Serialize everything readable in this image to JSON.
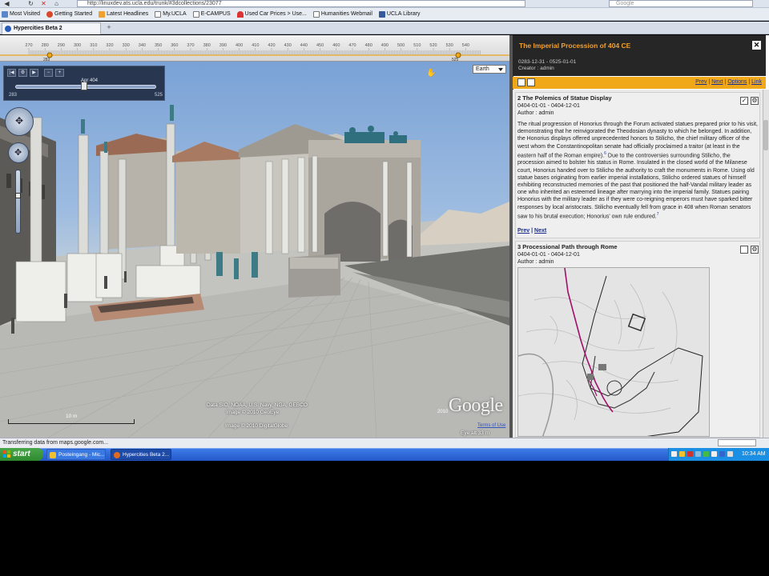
{
  "browser": {
    "url": "http://linuxdev.ats.ucla.edu/trunk/#3dcollections/23077",
    "search_placeholder": "Google",
    "bookmarks": [
      {
        "label": "Most Visited",
        "color": "#5b86c9"
      },
      {
        "label": "Getting Started",
        "color": "#d9482b"
      },
      {
        "label": "Latest Headlines",
        "color": "#f0a030"
      },
      {
        "label": "My.UCLA",
        "color": "#4a73b8"
      },
      {
        "label": "E-CAMPUS",
        "color": "#4a73b8"
      },
      {
        "label": "Used Car Prices > Use...",
        "color": "#d33"
      },
      {
        "label": "Humanities Webmail",
        "color": "#4a73b8"
      },
      {
        "label": "UCLA Library",
        "color": "#355a9c"
      }
    ],
    "tab_title": "Hypercities Beta 2",
    "status_text": "Transferring data from maps.google.com..."
  },
  "timeline": {
    "ticks": [
      "270",
      "280",
      "290",
      "300",
      "310",
      "320",
      "330",
      "340",
      "350",
      "360",
      "370",
      "380",
      "390",
      "400",
      "410",
      "420",
      "430",
      "440",
      "450",
      "460",
      "470",
      "480",
      "490",
      "500",
      "510",
      "520",
      "530",
      "540"
    ],
    "marker_left": "283",
    "marker_right": "525"
  },
  "earth": {
    "slider_label": "Apr 404",
    "slider_min": "283",
    "slider_max": "525",
    "slider_fraction": 0.5,
    "layer_select": "Earth",
    "footer_line1": "Data SIO, NOAA, U.S. Navy, NGA, GEBCO",
    "footer_line2": "Image © 2010 GeoEye",
    "footer_line3": "Image © 2010 DigitalGlobe",
    "google_logo": "Google",
    "google_year": "2010",
    "terms": "Terms of Use",
    "eye_alt": "Eye alt    33 m",
    "scale": "10 m"
  },
  "panel": {
    "title": "The Imperial Procession of 404 CE",
    "dates": "0283-12-31 - 0525-01-01",
    "creator": "Creator : admin",
    "nav": {
      "prev": "Prev",
      "next": "Next",
      "options": "Options",
      "link": "Link"
    },
    "cards": [
      {
        "title": "2 The Polemics of Statue Display",
        "dates": "0404-01-01 - 0404-12-01",
        "author": "Author : admin",
        "body_1": "The ritual progression of Honorius through the Forum activated statues prepared prior to his visit, demonstrating that he reinvigorated the Theodosian dynasty to which he belonged.  In addition, the Honorius displays offered unprecedented honors to Stilicho, the chief military officer of the west whom the Constantinopolitan senate had officially proclaimed a traitor (at least in the eastern half of the Roman empire).",
        "footnote_1": "6",
        "body_2": "  Due to the controversies surrounding Stilicho, the procession aimed to bolster his status in Rome.  Insulated in the closed world of the Milanese court, Honorius handed over to Stilicho the authority to craft the monuments in Rome.  Using old statue bases originating from earlier imperial installations, Stilicho ordered statues of himself exhibiting reconstructed memories of the past that positioned the half-Vandal military leader as one who inherited an esteemed lineage after marrying into the imperial family.  Statues pairing Honorius with the military leader as if they were co-reigning emperors must have sparked bitter responses by local aristocrats.  Stilicho eventually fell from grace in 408 when Roman senators saw to his brutal execution; Honorius' own rule endured.",
        "footnote_2": "7",
        "prev": "Prev",
        "next": "Next"
      },
      {
        "title": "3 Processional Path through Rome",
        "dates": "0404-01-01 - 0404-12-01",
        "author": "Author : admin"
      }
    ]
  },
  "taskbar": {
    "start": "start",
    "tasks": [
      {
        "label": "Posteingang - Mic...",
        "color": "#f0c030"
      },
      {
        "label": "Hypercities Beta 2...",
        "color": "#e06a20"
      }
    ],
    "clock": "10:34 AM"
  },
  "colors": {
    "panel_accent": "#f0a818",
    "panel_title": "#f0a030",
    "procession_path": "#a0106a"
  }
}
